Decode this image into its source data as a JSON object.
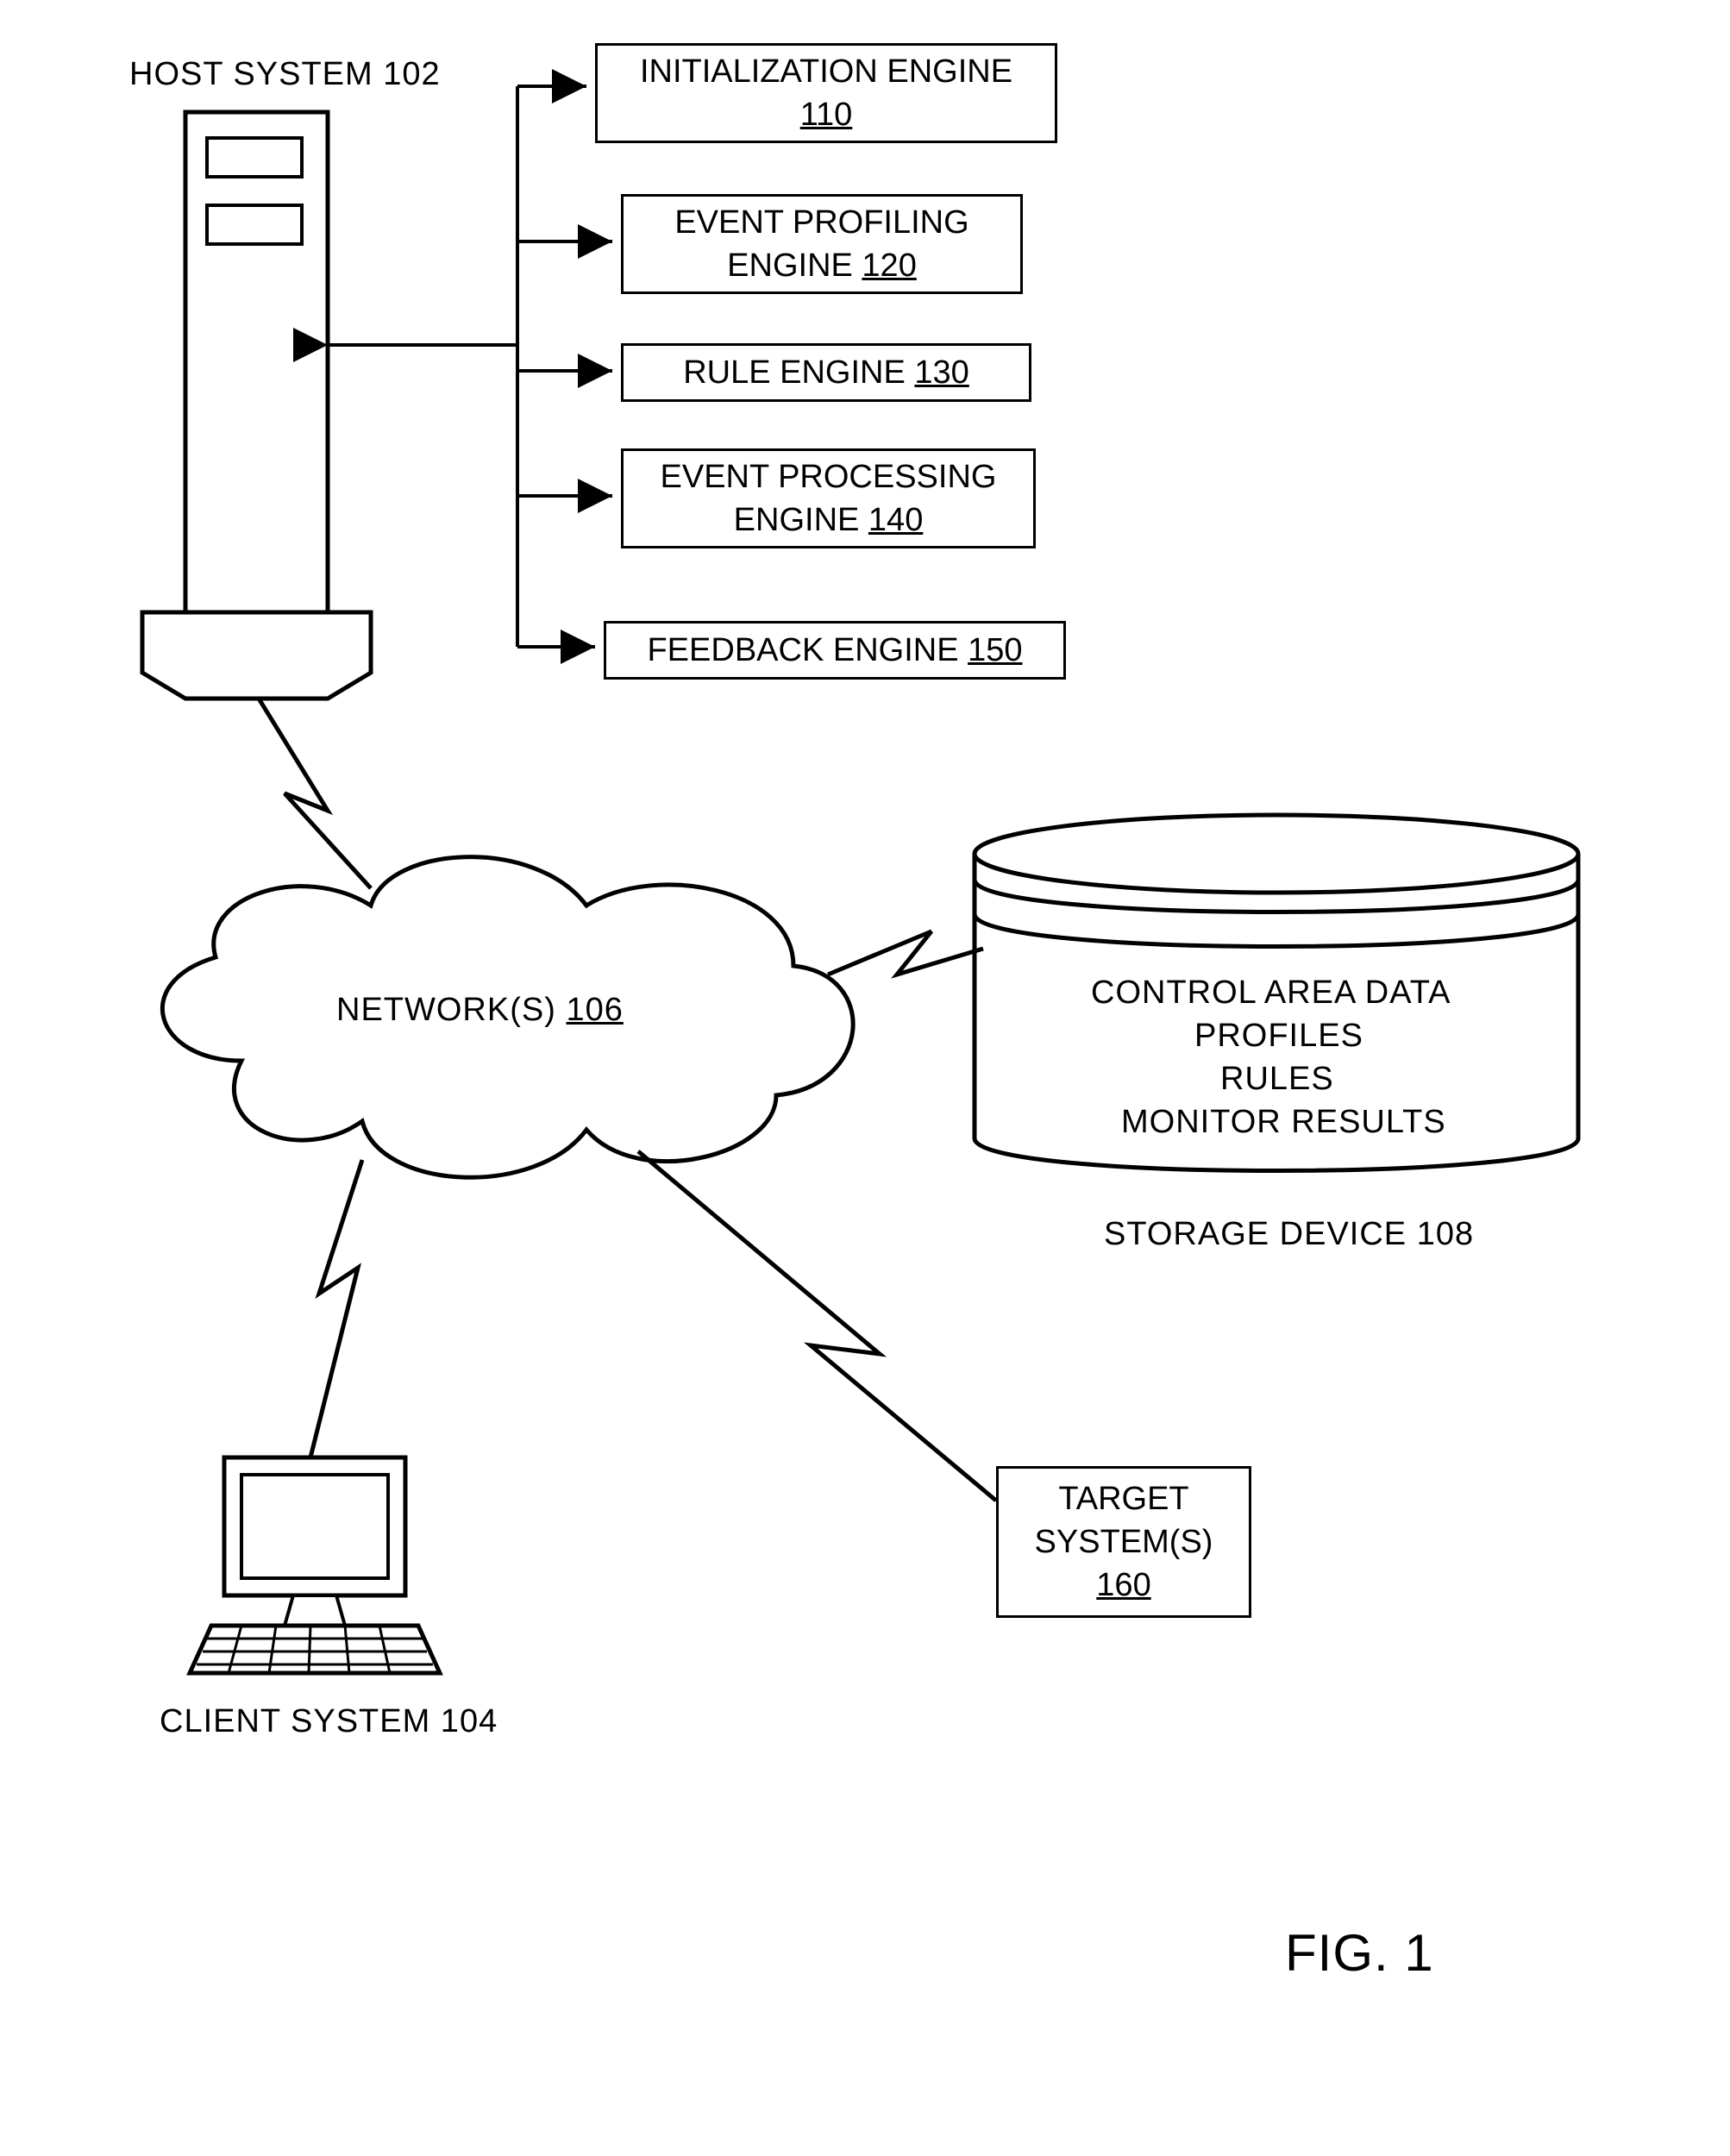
{
  "host_system_label": "HOST SYSTEM 102",
  "engines": {
    "init": {
      "label": "INITIALIZATION ENGINE",
      "num": "110"
    },
    "profile": {
      "label": "EVENT PROFILING",
      "label2": "ENGINE ",
      "num": "120"
    },
    "rule": {
      "label": "RULE ENGINE ",
      "num": "130"
    },
    "process": {
      "label": "EVENT PROCESSING",
      "label2": "ENGINE ",
      "num": "140"
    },
    "feedback": {
      "label": "FEEDBACK ENGINE ",
      "num": "150"
    }
  },
  "network": {
    "label": "NETWORK(S) ",
    "num": "106"
  },
  "storage": {
    "lines": [
      "CONTROL AREA DATA",
      "PROFILES",
      "RULES",
      "MONITOR RESULTS"
    ],
    "label": "STORAGE DEVICE 108"
  },
  "target": {
    "line1": "TARGET",
    "line2": "SYSTEM(S)",
    "num": "160"
  },
  "client_label": "CLIENT SYSTEM 104",
  "fig_label": "FIG. 1"
}
